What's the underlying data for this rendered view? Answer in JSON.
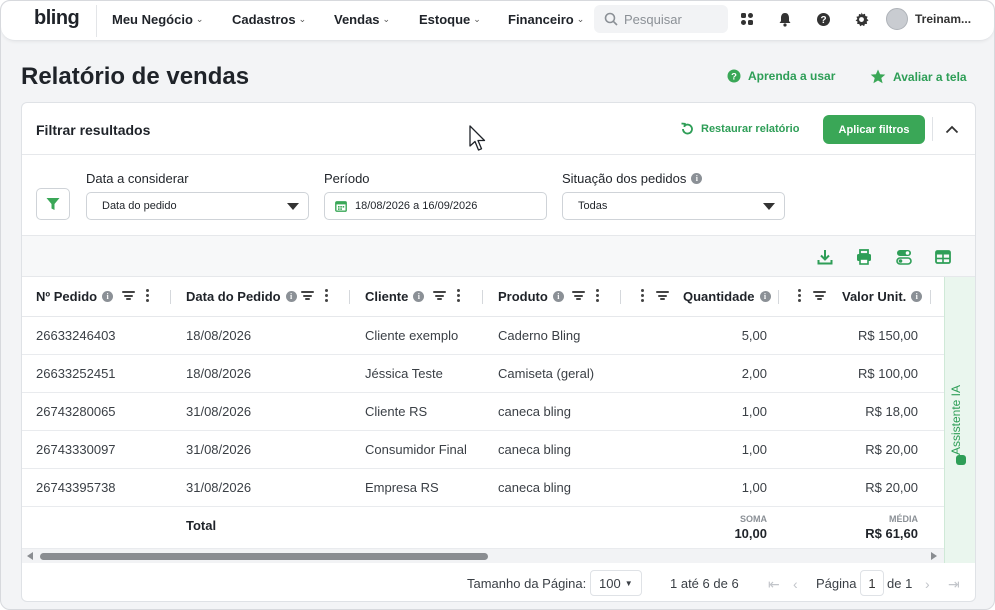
{
  "app": {
    "logo": "bling",
    "user": "Treinam..."
  },
  "nav": {
    "items": [
      {
        "label": "Meu Negócio"
      },
      {
        "label": "Cadastros"
      },
      {
        "label": "Vendas"
      },
      {
        "label": "Estoque"
      },
      {
        "label": "Financeiro"
      }
    ],
    "search_placeholder": "Pesquisar",
    "icons": [
      "apps-icon",
      "bell-icon",
      "help-icon",
      "gear-icon"
    ]
  },
  "page": {
    "title": "Relatório de vendas",
    "learn_link": "Aprenda a usar",
    "rate_link": "Avaliar a tela"
  },
  "filters": {
    "title": "Filtrar resultados",
    "restore_label": "Restaurar relatório",
    "apply_label": "Aplicar filtros",
    "date_field": {
      "label": "Data a considerar",
      "value": "Data do pedido"
    },
    "period": {
      "label": "Período",
      "value": "18/08/2026 a 16/09/2026"
    },
    "status": {
      "label": "Situação dos pedidos",
      "value": "Todas"
    }
  },
  "table": {
    "columns": [
      "Nº Pedido",
      "Data do Pedido",
      "Cliente",
      "Produto",
      "Quantidade",
      "Valor Unit."
    ],
    "rows": [
      [
        "26633246403",
        "18/08/2026",
        "Cliente exemplo",
        "Caderno Bling",
        "5,00",
        "R$ 150,00"
      ],
      [
        "26633252451",
        "18/08/2026",
        "Jéssica Teste",
        "Camiseta (geral)",
        "2,00",
        "R$ 100,00"
      ],
      [
        "26743280065",
        "31/08/2026",
        "Cliente RS",
        "caneca bling",
        "1,00",
        "R$ 18,00"
      ],
      [
        "26743330097",
        "31/08/2026",
        "Consumidor Final",
        "caneca bling",
        "1,00",
        "R$ 20,00"
      ],
      [
        "26743395738",
        "31/08/2026",
        "Empresa RS",
        "caneca bling",
        "1,00",
        "R$ 20,00"
      ]
    ],
    "total": {
      "label": "Total",
      "quantity_agg_label": "SOMA",
      "quantity_agg_value": "10,00",
      "price_agg_label": "MÉDIA",
      "price_agg_value": "R$ 61,60"
    }
  },
  "side_panel": {
    "label": "Assistente IA"
  },
  "pagination": {
    "page_size_label": "Tamanho da Página:",
    "page_size": "100",
    "range": "1 até 6 de 6",
    "page_label": "Página",
    "page": "1",
    "of_label": "de 1"
  },
  "colors": {
    "accent": "#3aa757",
    "accent_text": "#2e9e57"
  }
}
